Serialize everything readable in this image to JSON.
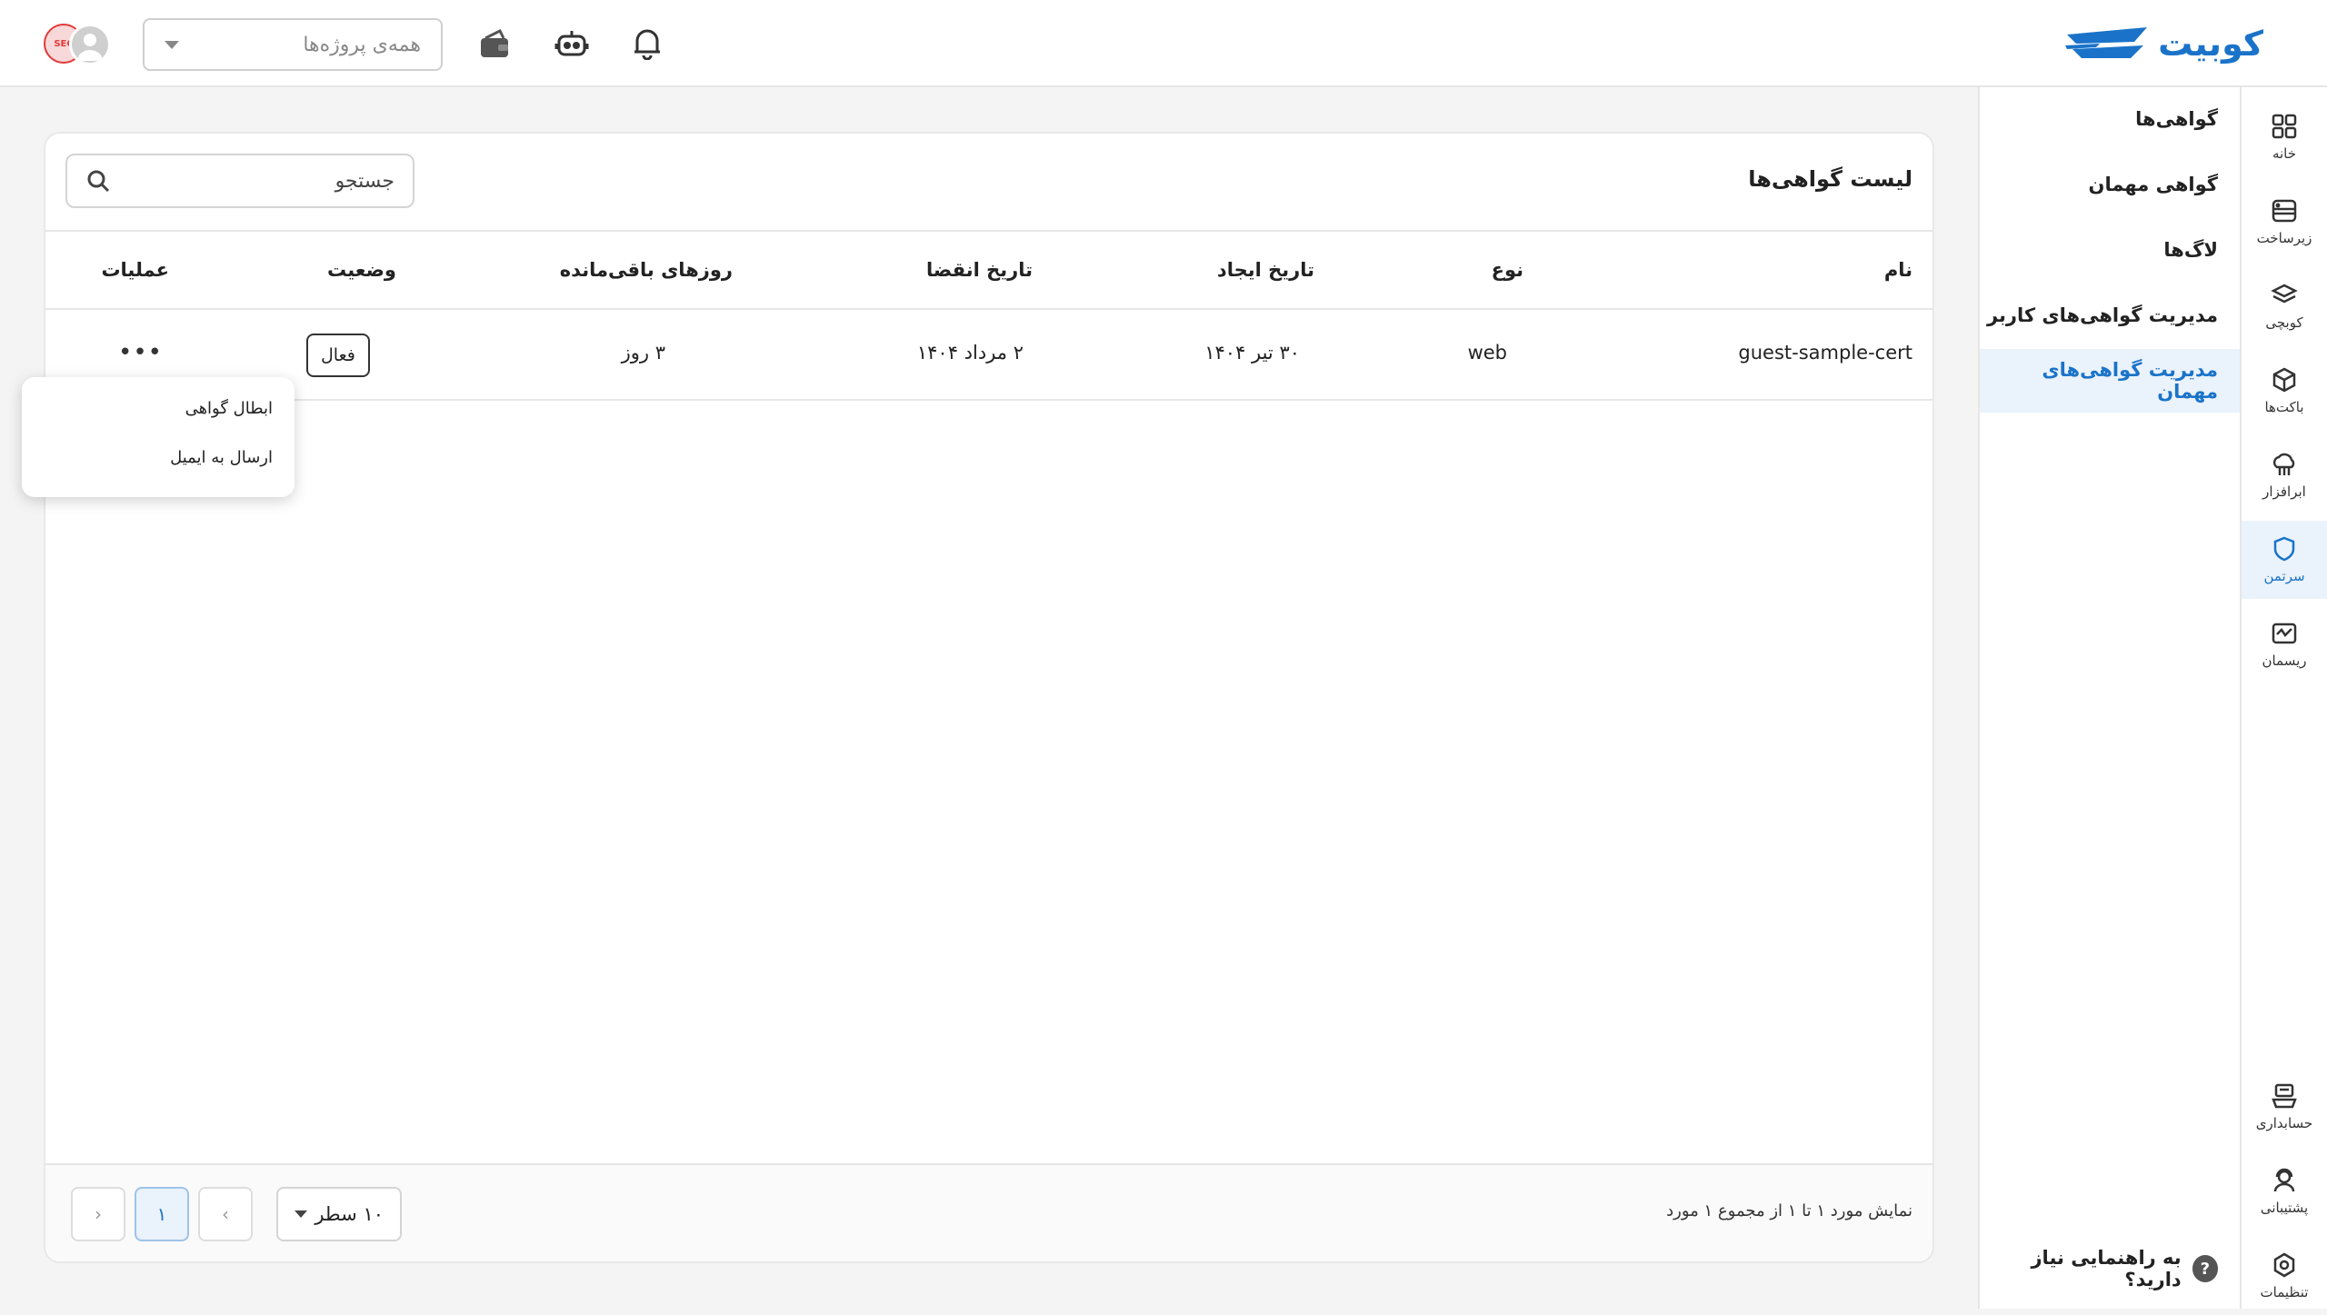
{
  "header": {
    "logo_text": "کوبیت",
    "project_select": {
      "placeholder": "همه‌ی پروژه‌ها"
    },
    "icons": [
      "bell-icon",
      "robot-icon",
      "wallet-icon"
    ],
    "avatar_badge": "SEC"
  },
  "rail": {
    "items": [
      {
        "label": "خانه",
        "icon": "grid-icon"
      },
      {
        "label": "زیرساخت",
        "icon": "server-icon"
      },
      {
        "label": "کوبچی",
        "icon": "layers-icon"
      },
      {
        "label": "باکت‌ها",
        "icon": "box-icon"
      },
      {
        "label": "ابرافزار",
        "icon": "cloud-icon"
      },
      {
        "label": "سرتمن",
        "icon": "shield-icon",
        "active": true
      },
      {
        "label": "ریسمان",
        "icon": "chart-icon"
      }
    ],
    "bottom_items": [
      {
        "label": "حسابداری",
        "icon": "accounting-icon"
      },
      {
        "label": "پشتیبانی",
        "icon": "support-icon"
      },
      {
        "label": "تنظیمات",
        "icon": "settings-icon"
      }
    ]
  },
  "submenu": {
    "items": [
      {
        "label": "گواهی‌ها"
      },
      {
        "label": "گواهی مهمان"
      },
      {
        "label": "لاگ‌ها"
      },
      {
        "label": "مدیریت گواهی‌های کاربر"
      },
      {
        "label": "مدیریت گواهی‌های مهمان",
        "active": true
      }
    ],
    "help": "به راهنمایی نیاز دارید؟"
  },
  "main": {
    "title": "لیست گواهی‌ها",
    "search_placeholder": "جستجو",
    "columns": [
      "نام",
      "نوع",
      "تاریخ ایجاد",
      "تاریخ انقضا",
      "روزهای باقی‌مانده",
      "وضعیت",
      "عملیات"
    ],
    "rows": [
      {
        "name": "guest-sample-cert",
        "type": "web",
        "created": "۳۰ تیر ۱۴۰۴",
        "expires": "۲ مرداد ۱۴۰۴",
        "remaining": "۳ روز",
        "status": "فعال",
        "actions": "•••"
      }
    ],
    "row_menu": [
      "ابطال گواهی",
      "ارسال به ایمیل"
    ],
    "footer": {
      "info": "نمایش مورد ۱ تا ۱ از مجموع ۱ مورد",
      "rows_per_page": "۱۰ سطر",
      "current_page": "۱"
    }
  },
  "colors": {
    "accent": "#1a73c9",
    "active_bg": "#eaf2fb"
  }
}
